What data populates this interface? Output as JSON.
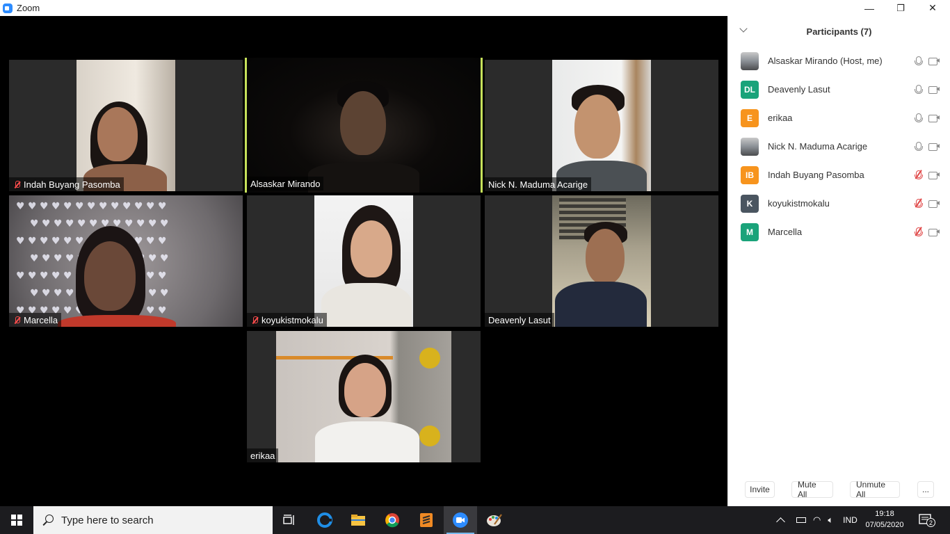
{
  "window": {
    "title": "Zoom",
    "controls": {
      "minimize": "—",
      "restore": "❐",
      "close": "✕"
    }
  },
  "video_tiles": [
    {
      "name": "Indah Buyang Pasomba",
      "muted": true
    },
    {
      "name": "Alsaskar Mirando",
      "muted": false,
      "active_speaker": true
    },
    {
      "name": "Nick N. Maduma Acarige",
      "muted": false
    },
    {
      "name": "Marcella",
      "muted": true
    },
    {
      "name": "koyukistmokalu",
      "muted": true
    },
    {
      "name": "Deavenly Lasut",
      "muted": false
    },
    {
      "name": "erikaa",
      "muted": false
    }
  ],
  "participants_panel": {
    "title": "Participants (7)",
    "participants": [
      {
        "name": "Alsaskar Mirando (Host, me)",
        "avatar": "photo",
        "initials": "",
        "color": "",
        "mic": "on"
      },
      {
        "name": "Deavenly Lasut",
        "avatar": "initials",
        "initials": "DL",
        "color": "#1aa37a",
        "mic": "on"
      },
      {
        "name": "erikaa",
        "avatar": "initials",
        "initials": "E",
        "color": "#f7941d",
        "mic": "on"
      },
      {
        "name": "Nick N. Maduma Acarige",
        "avatar": "photo",
        "initials": "",
        "color": "",
        "mic": "on"
      },
      {
        "name": "Indah Buyang Pasomba",
        "avatar": "initials",
        "initials": "IB",
        "color": "#f7941d",
        "mic": "muted"
      },
      {
        "name": "koyukistmokalu",
        "avatar": "initials",
        "initials": "K",
        "color": "#4a5560",
        "mic": "muted"
      },
      {
        "name": "Marcella",
        "avatar": "initials",
        "initials": "M",
        "color": "#1aa37a",
        "mic": "muted"
      }
    ],
    "buttons": {
      "invite": "Invite",
      "mute_all": "Mute All",
      "unmute_all": "Unmute All",
      "more": "..."
    }
  },
  "taskbar": {
    "search_placeholder": "Type here to search",
    "language": "IND",
    "time": "19:18",
    "date": "07/05/2020",
    "notification_count": "2"
  }
}
